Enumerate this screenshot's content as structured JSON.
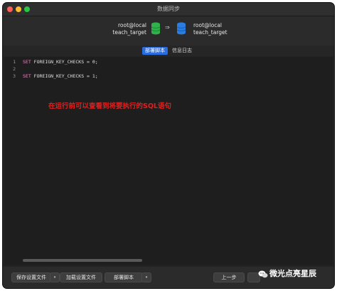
{
  "window": {
    "title": "数据同步"
  },
  "connection": {
    "source": {
      "host": "root@local",
      "database": "teach_target"
    },
    "target": {
      "host": "root@local",
      "database": "teach_target"
    },
    "arrow": "⇒"
  },
  "tabs": [
    {
      "label": "部署脚本",
      "active": true
    },
    {
      "label": "信息日志",
      "active": false
    }
  ],
  "editor": {
    "lines": [
      {
        "num": "1",
        "keyword": "SET",
        "rest": " FOREIGN_KEY_CHECKS = 0;"
      },
      {
        "num": "2",
        "keyword": "",
        "rest": ""
      },
      {
        "num": "3",
        "keyword": "SET",
        "rest": " FOREIGN_KEY_CHECKS = 1;"
      }
    ],
    "annotation": "在运行前可以查看到将要执行的SQL语句"
  },
  "footer": {
    "save_settings": "保存设置文件",
    "load_settings": "加载设置文件",
    "deploy_script": "部署脚本",
    "prev_step": "上一步",
    "dropdown_glyph": "▾"
  },
  "watermark": "微光点亮星辰",
  "colors": {
    "accent": "#2a6de0",
    "source_db": "#2fb24c",
    "target_db": "#2a7de1",
    "annotation": "#e0201e"
  }
}
